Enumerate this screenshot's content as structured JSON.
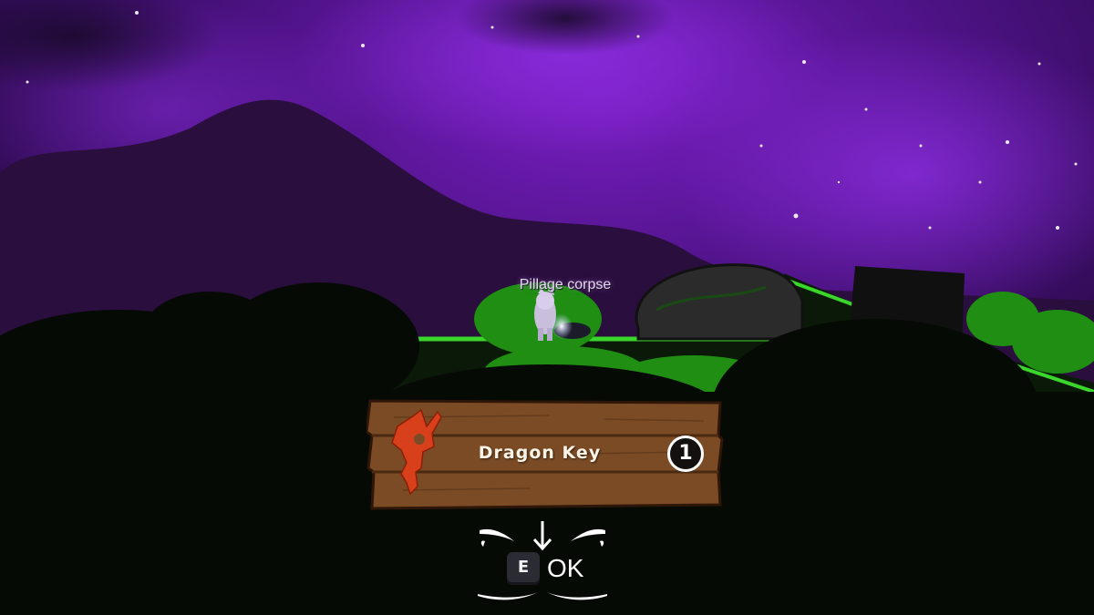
{
  "interaction_prompt": "Pillage corpse",
  "loot": {
    "item_name": "Dragon Key",
    "quantity": "1",
    "icon": "dragon-key-icon"
  },
  "confirm": {
    "key": "E",
    "label": "OK",
    "icon": "arrow-down-icon"
  },
  "colors": {
    "sky": "#5b1496",
    "grass": "#38d12a",
    "panel_wood": "#7a4a26",
    "key_red": "#d8401c"
  }
}
